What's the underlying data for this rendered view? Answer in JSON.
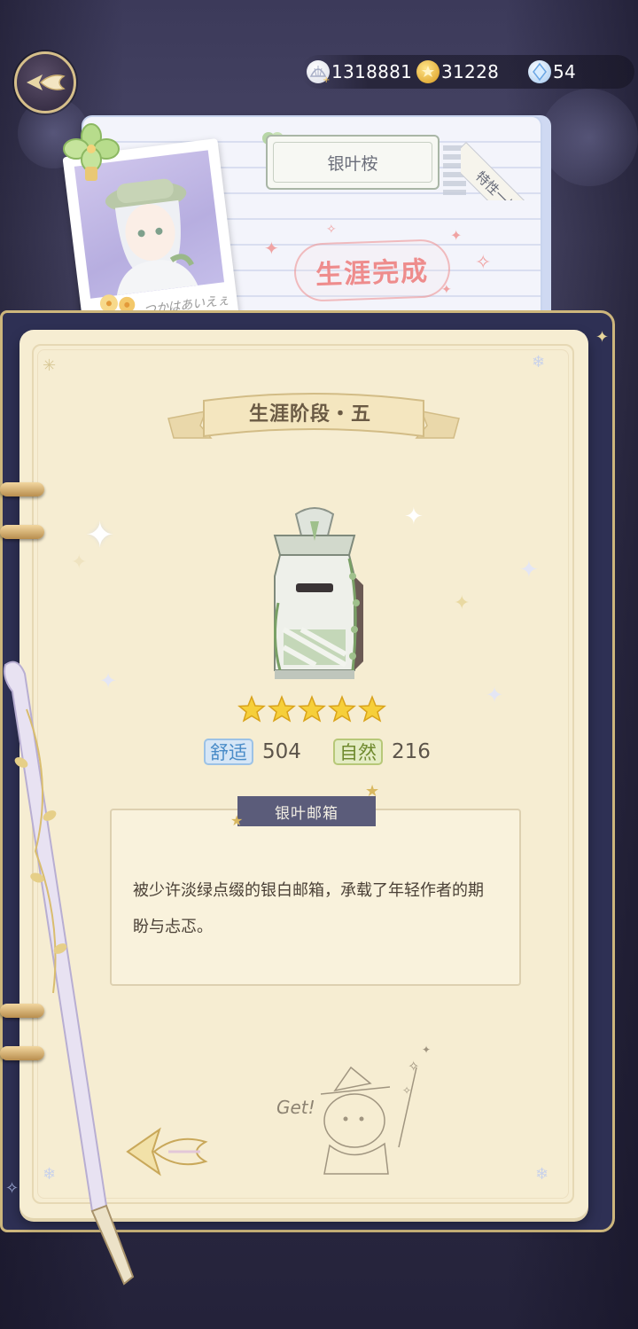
{
  "currency": {
    "shells": "1318881",
    "gold": "31228",
    "crystal": "54"
  },
  "profile": {
    "character_name": "银叶桉",
    "trait_tab_label": "特性一览",
    "career_status": "生涯完成",
    "photo_caption": "つかはあいえぇ"
  },
  "stage": {
    "title": "生涯阶段・五"
  },
  "item": {
    "stars": 5,
    "comfort_label": "舒适",
    "comfort_value": "504",
    "nature_label": "自然",
    "nature_value": "216",
    "name": "银叶邮箱",
    "description": "被少许淡绿点缀的银白邮箱，承载了年轻作者的期盼与忐忑。"
  },
  "sticker_text": "Get!",
  "colors": {
    "comfort_tag_bg": "#d6e6f6",
    "comfort_tag_text": "#4a8cc8",
    "nature_tag_bg": "#e4ecc4",
    "nature_tag_text": "#6f8a2e",
    "page_bg": "#f6edd2",
    "stamp": "#ee8c8c"
  },
  "icons": {
    "back": "back-arrow-icon",
    "shells": "shell-coin-icon",
    "gold": "gold-coin-icon",
    "crystal": "crystal-icon",
    "prev_page": "prev-page-arrow-icon"
  }
}
